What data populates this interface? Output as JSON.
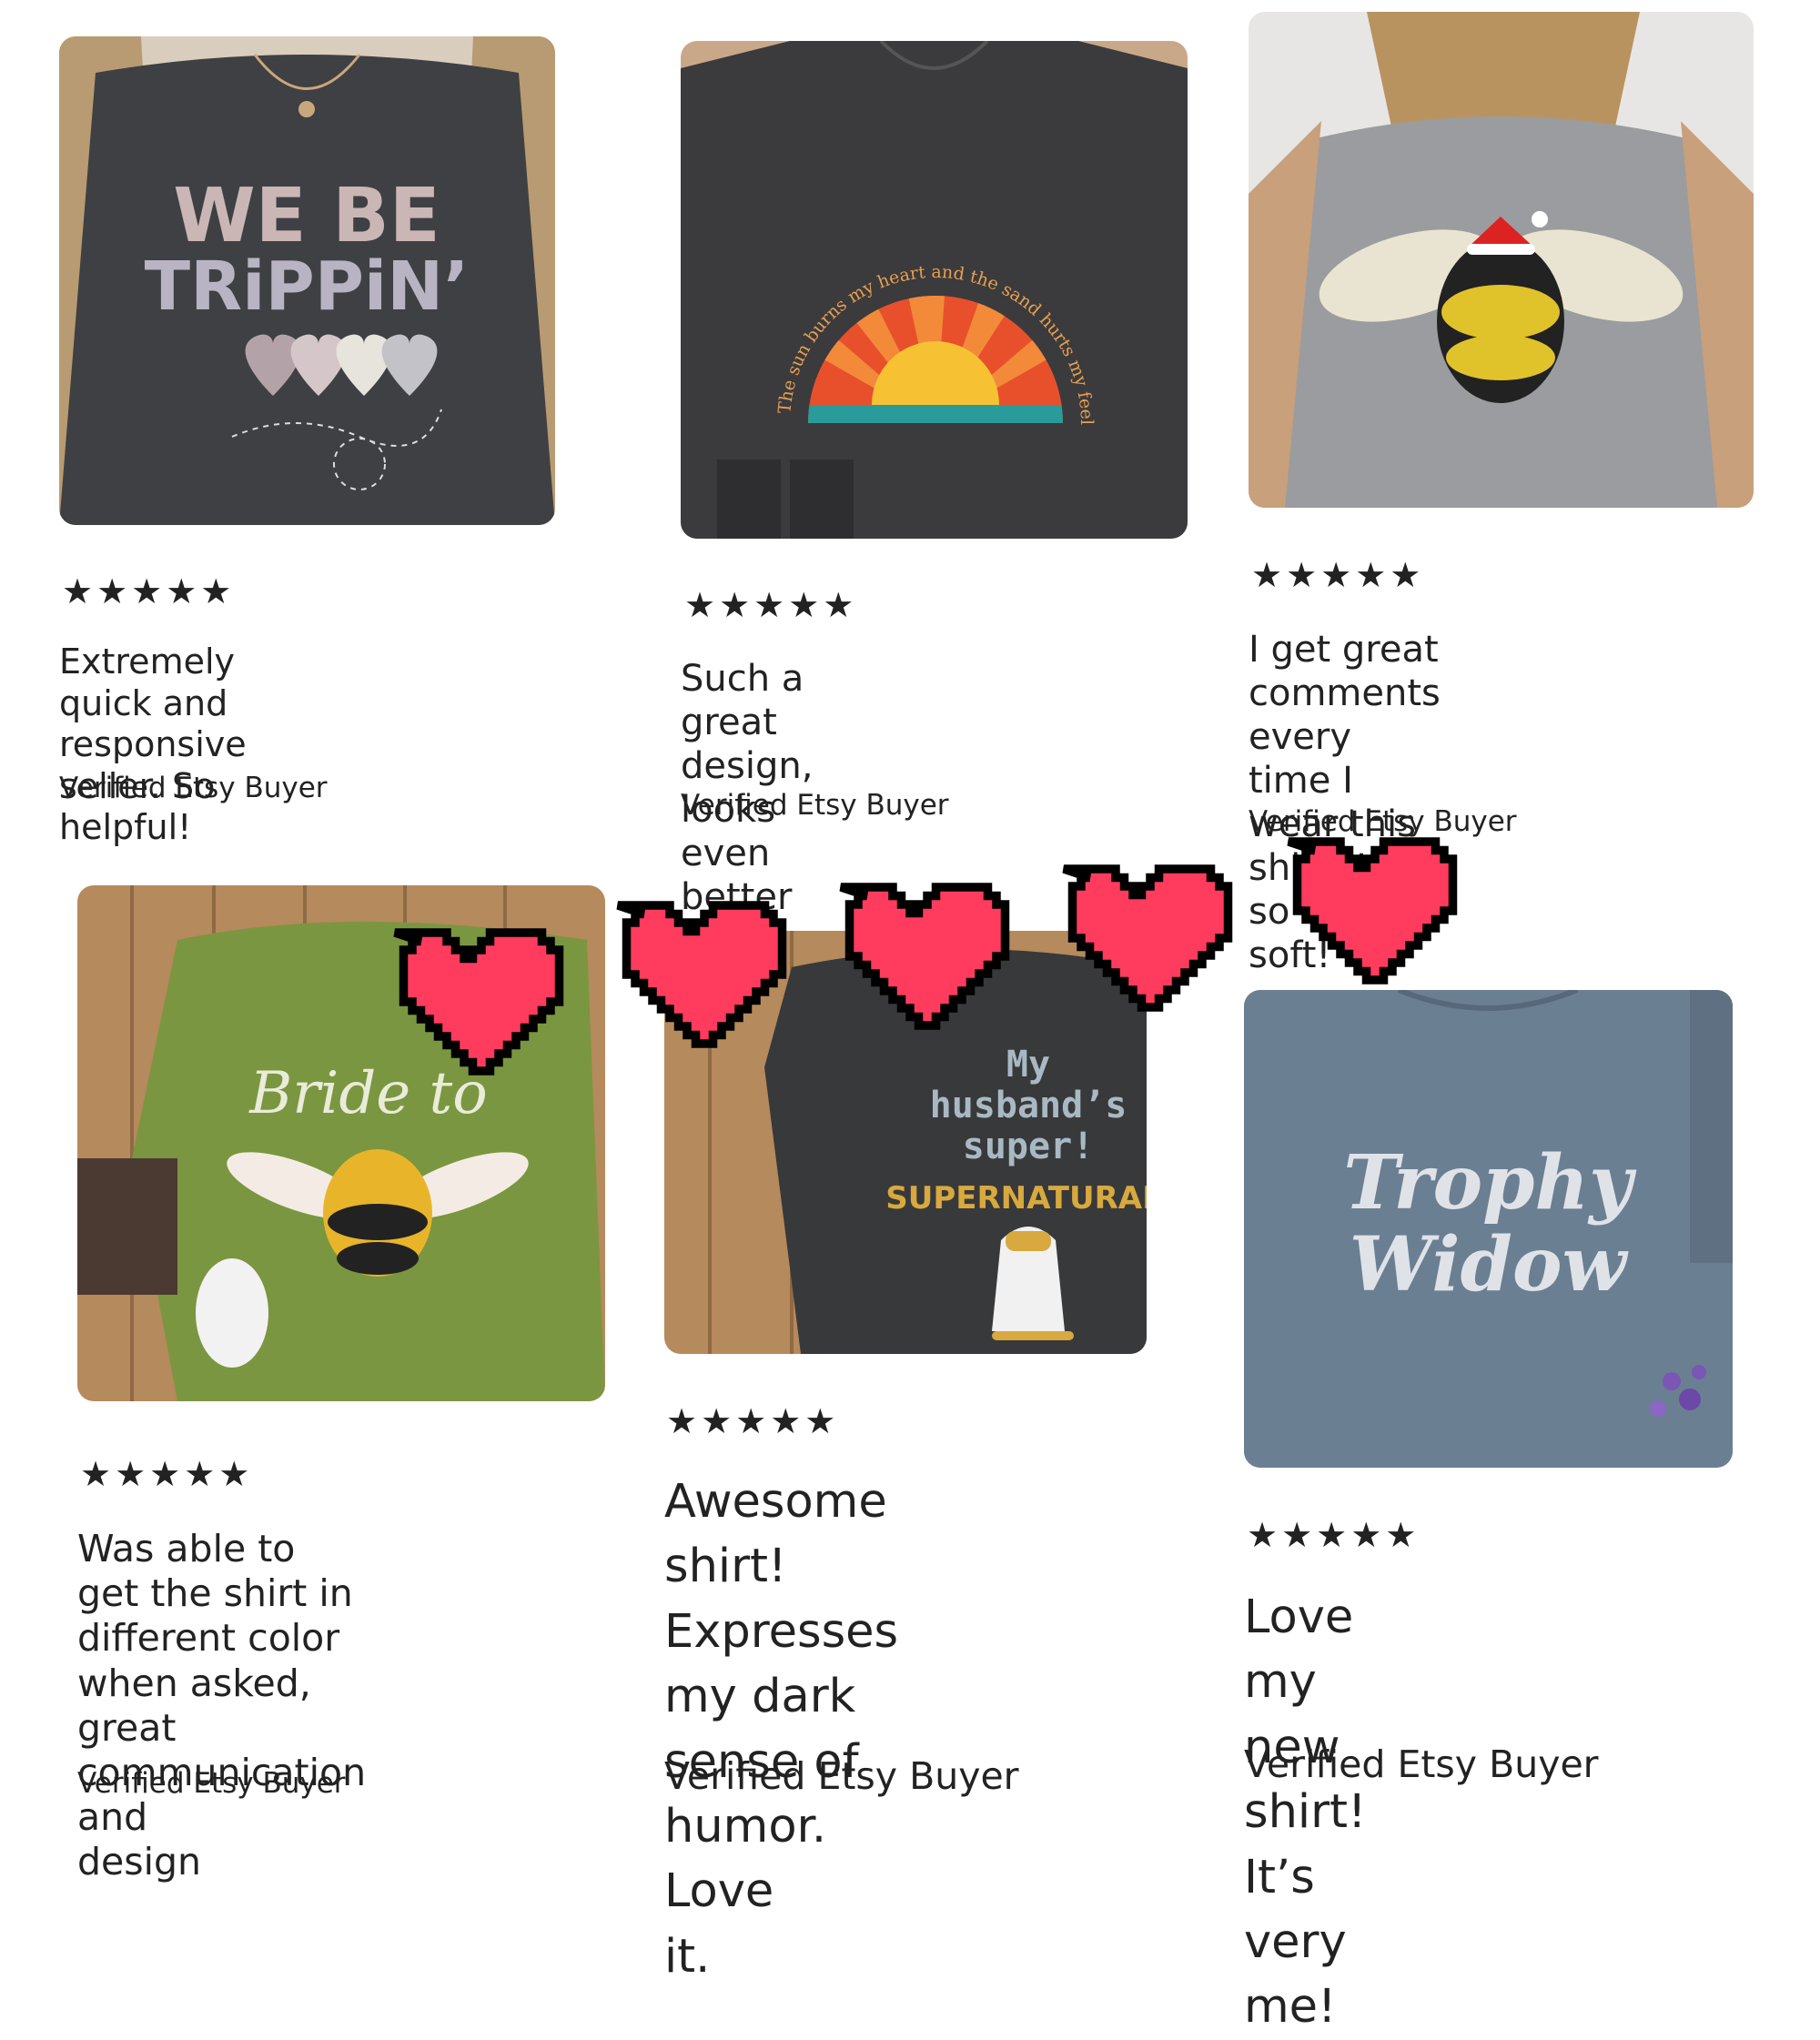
{
  "reviews": [
    {
      "rating": 5,
      "stars": "★★★★★",
      "text": "Extremely quick and\nresponsive seller. So helpful!",
      "buyer": "Verified Etsy Buyer",
      "shirt": {
        "print_lines": [
          "WE BE",
          "TRiPPiN’"
        ],
        "color": "#3f4043"
      }
    },
    {
      "rating": 5,
      "stars": "★★★★★",
      "text": "Such a great design, looks\neven better in person!",
      "buyer": "Verified Etsy Buyer",
      "shirt": {
        "print_arc": "The sun burns my heart and the sand hurts my feelings",
        "color": "#3b3b3d"
      }
    },
    {
      "rating": 5,
      "stars": "★★★★★",
      "text": "I get great comments every\ntime I wear this shirt! It’s so\nsoft!",
      "buyer": "Verified Etsy Buyer",
      "shirt": {
        "color": "#9a9c9f"
      }
    },
    {
      "rating": 5,
      "stars": "★★★★★",
      "text": "Was able to get the shirt in\ndifferent color when asked,\ngreat communication and\ndesign",
      "buyer": "Verified Etsy Buyer",
      "shirt": {
        "print_lines": [
          "Bride to"
        ],
        "color": "#7b9640"
      }
    },
    {
      "rating": 5,
      "stars": "★★★★★",
      "text": "Awesome shirt!\nExpresses my dark\nsense of humor. Love\nit.",
      "buyer": "Verified Etsy Buyer",
      "shirt": {
        "print_lines": [
          "My",
          "husband’s",
          "super!",
          "SUPERNATURAL"
        ],
        "color": "#38393b"
      }
    },
    {
      "rating": 5,
      "stars": "★★★★★",
      "text": "Love my new shirt! It’s\nvery me!",
      "buyer": "Verified Etsy Buyer",
      "shirt": {
        "print_lines": [
          "Trophy",
          "Widow"
        ],
        "color": "#6b7f93"
      }
    }
  ],
  "colors": {
    "heart": "#ff3b5e",
    "heart_outline": "#000000",
    "text": "#222222",
    "wood": "#b58a5c"
  }
}
